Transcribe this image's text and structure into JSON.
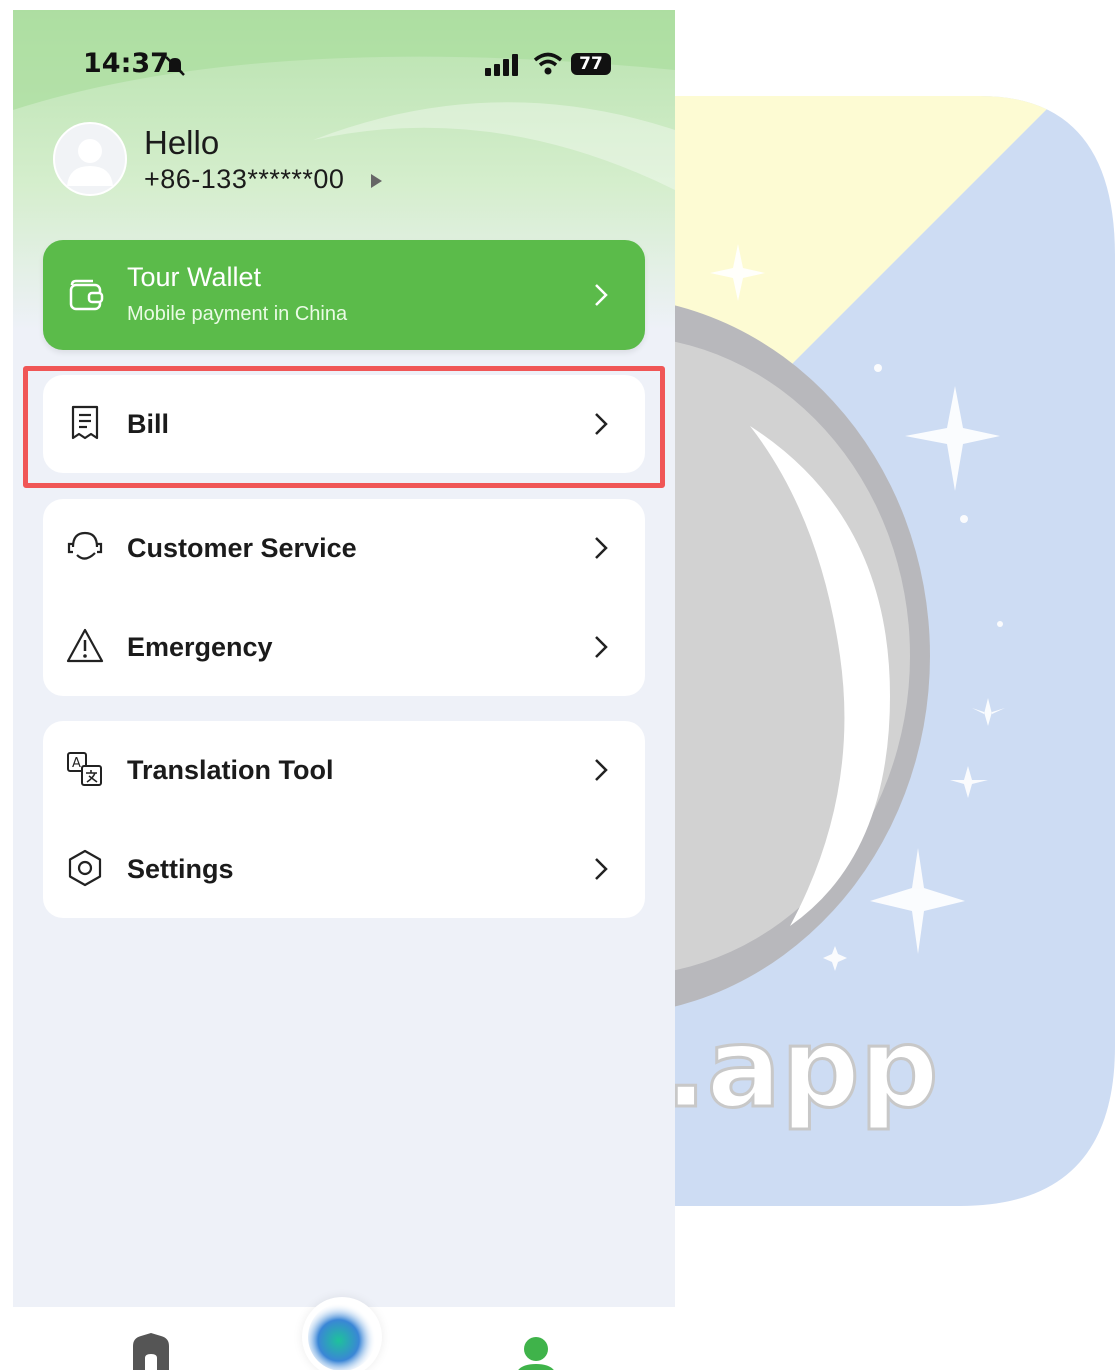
{
  "status_bar": {
    "time": "14:37",
    "battery": "77"
  },
  "profile": {
    "greeting": "Hello",
    "phone": "+86-133******00"
  },
  "wallet": {
    "title": "Tour Wallet",
    "subtitle": "Mobile payment in China"
  },
  "menu": {
    "bill": "Bill",
    "customer_service": "Customer Service",
    "emergency": "Emergency",
    "translation_tool": "Translation Tool",
    "settings": "Settings"
  },
  "background_logo": {
    "text": ".app"
  },
  "colors": {
    "brand_green": "#5bbb4a",
    "highlight_red": "#f05656",
    "page_bg": "#eef1f8"
  }
}
